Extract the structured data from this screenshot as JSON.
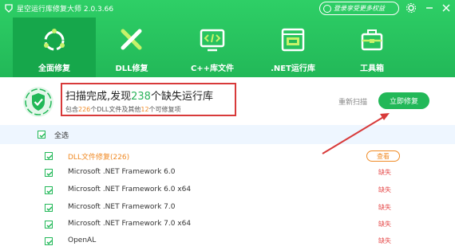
{
  "app": {
    "title": "星空运行库修复大师 2.0.3.66",
    "login_label": "登录享受更多权益"
  },
  "nav": {
    "tabs": [
      {
        "label": "全面修复",
        "icon": "full-repair-icon",
        "active": true
      },
      {
        "label": "DLL修复",
        "icon": "dll-tools-icon",
        "active": false
      },
      {
        "label": "C++库文件",
        "icon": "cpp-code-icon",
        "active": false
      },
      {
        "label": ".NET运行库",
        "icon": "dotnet-icon",
        "active": false
      },
      {
        "label": "工具箱",
        "icon": "toolbox-icon",
        "active": false
      }
    ]
  },
  "status": {
    "title_pre": "扫描完成,发现",
    "missing_count": "238",
    "title_post": "个缺失运行库",
    "sub_pre": "包含",
    "dll_count": "226",
    "sub_mid": "个DLL文件及其他",
    "other_count": "12",
    "sub_post": "个可修复项",
    "rescan_label": "重新扫描",
    "fix_label": "立即修复"
  },
  "list": {
    "select_all_label": "全选",
    "rows": [
      {
        "name": "DLL文件修复(226)",
        "status": "查看"
      },
      {
        "name": "Microsoft .NET Framework 6.0",
        "status": "缺失"
      },
      {
        "name": "Microsoft .NET Framework 6.0 x64",
        "status": "缺失"
      },
      {
        "name": "Microsoft .NET Framework 7.0",
        "status": "缺失"
      },
      {
        "name": "Microsoft .NET Framework 7.0 x64",
        "status": "缺失"
      },
      {
        "name": "OpenAL",
        "status": "缺失"
      }
    ]
  },
  "colors": {
    "brand_green": "#22b858",
    "accent_orange": "#f08a24",
    "missing_red": "#e54848",
    "annotation_red": "#d83a3a"
  }
}
